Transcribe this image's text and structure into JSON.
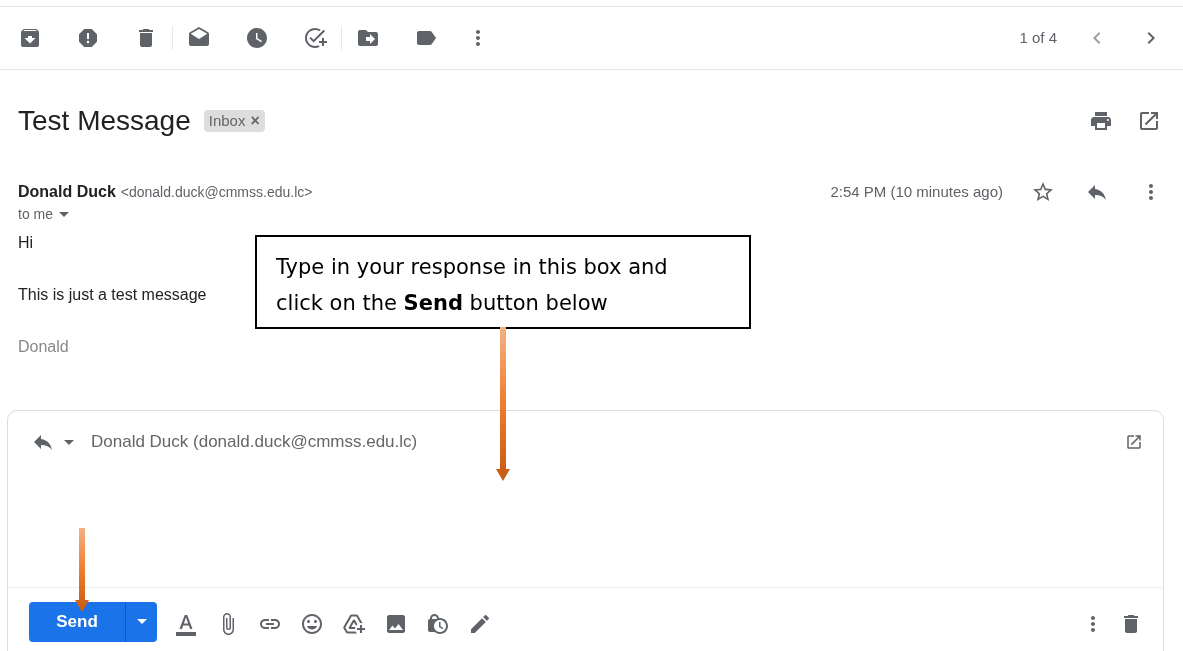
{
  "toolbar": {
    "pager": "1 of 4"
  },
  "message": {
    "subject": "Test Message",
    "label": "Inbox",
    "label_close": "×",
    "sender_name": "Donald Duck",
    "sender_email": "<donald.duck@cmmss.edu.lc>",
    "recipient": "to me",
    "time": "2:54 PM (10 minutes ago)",
    "body": [
      "Hi",
      "This is just a test message"
    ],
    "signature": "Donald"
  },
  "reply": {
    "to": "Donald Duck (donald.duck@cmmss.edu.lc)",
    "send_label": "Send"
  },
  "callout": {
    "text": "Type in your response in this box and click on the **Send** button below"
  }
}
